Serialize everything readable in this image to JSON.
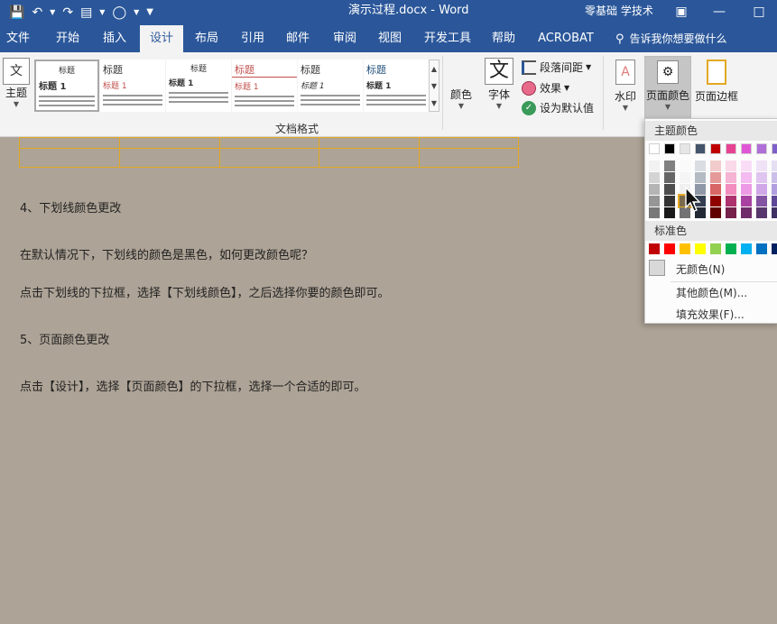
{
  "titlebar": {
    "doc_title": "演示过程.docx  -  Word",
    "user_name": "零基础 学技术",
    "bg_color": "#2b579a"
  },
  "tabs": [
    "文件",
    "开始",
    "插入",
    "设计",
    "布局",
    "引用",
    "邮件",
    "审阅",
    "视图",
    "开发工具",
    "帮助",
    "ACROBAT"
  ],
  "active_tab": "设计",
  "tellme": {
    "placeholder": "告诉我你想要做什么",
    "icon": "lightbulb-icon"
  },
  "ribbon": {
    "theme_label": "主题",
    "gallery_heading": "标题",
    "gallery_heading_alt": "标题 1",
    "group_label": "文档格式",
    "colors_label": "颜色",
    "fonts_label": "字体",
    "font_icon_char": "文",
    "paragraph_spacing_label": "段落间距",
    "effects_label": "效果",
    "set_default_label": "设为默认值",
    "watermark_label": "水印",
    "page_color_label": "页面颜色",
    "page_border_label": "页面边框"
  },
  "document": {
    "heading4": "4、下划线颜色更改",
    "para1": "在默认情况下，下划线的颜色是黑色，如何更改颜色呢？",
    "para2": "点击下划线的下拉框，选择【下划线颜色】，之后选择你要的颜色即可。",
    "heading5": "5、页面颜色更改",
    "para3": "点击【设计】，选择【页面颜色】的下拉框，选择一个合适的即可。",
    "page_bg_color": "#ada396",
    "table_border_color": "#e3a823"
  },
  "dropdown": {
    "theme_colors_title": "主题颜色",
    "standard_colors_title": "标准色",
    "no_color_label": "无颜色(N)",
    "more_colors_label": "其他颜色(M)...",
    "fill_effects_label": "填充效果(F)...",
    "theme_row": [
      "#ffffff",
      "#000000",
      "#e7e6e6",
      "#44546a",
      "#c00000",
      "#e84393",
      "#e056d6",
      "#b06ed8",
      "#7e5fc9",
      "#4472c4"
    ],
    "standard_row": [
      "#c00000",
      "#ff0000",
      "#ffc000",
      "#ffff00",
      "#92d050",
      "#00b050",
      "#00b0f0",
      "#0070c0",
      "#002060"
    ],
    "selected_swatch": "#7b6a4c"
  }
}
